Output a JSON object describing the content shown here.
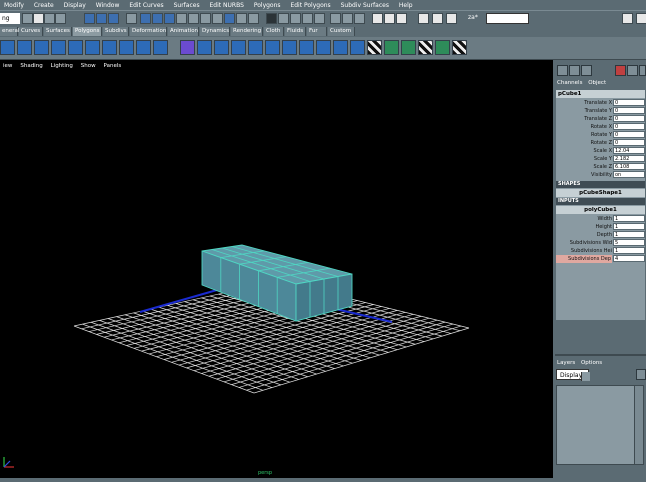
{
  "menubar": [
    "Modify",
    "Create",
    "Display",
    "Window",
    "Edit Curves",
    "Surfaces",
    "Edit NURBS",
    "Polygons",
    "Edit Polygons",
    "Subdiv Surfaces",
    "Help"
  ],
  "status": {
    "mode": "ng",
    "zoom_label": "za*"
  },
  "shelf_tabs": [
    "eneral",
    "Curves",
    "Surfaces",
    "Polygons",
    "Subdivs",
    "Deformation",
    "Animation",
    "Dynamics",
    "Rendering",
    "Cloth",
    "Fluids",
    "Fur",
    "Custom"
  ],
  "shelf_active": "Polygons",
  "view_menu": [
    "iew",
    "Shading",
    "Lighting",
    "Show",
    "Panels"
  ],
  "channel_box": {
    "tabs": [
      "Channels",
      "Object"
    ],
    "node": "pCube1",
    "attributes": [
      {
        "label": "Translate X",
        "value": "0"
      },
      {
        "label": "Translate Y",
        "value": "0"
      },
      {
        "label": "Translate Z",
        "value": "0"
      },
      {
        "label": "Rotate X",
        "value": "0"
      },
      {
        "label": "Rotate Y",
        "value": "0"
      },
      {
        "label": "Rotate Z",
        "value": "0"
      },
      {
        "label": "Scale X",
        "value": "12.04"
      },
      {
        "label": "Scale Y",
        "value": "2.182"
      },
      {
        "label": "Scale Z",
        "value": "6.108"
      },
      {
        "label": "Visibility",
        "value": "on"
      }
    ],
    "shapes_header": "SHAPES",
    "shape_node": "pCubeShape1",
    "inputs_header": "INPUTS",
    "input_node": "polyCube1",
    "input_attributes": [
      {
        "label": "Width",
        "value": "1"
      },
      {
        "label": "Height",
        "value": "1"
      },
      {
        "label": "Depth",
        "value": "1"
      },
      {
        "label": "Subdivisions Wid",
        "value": "5"
      },
      {
        "label": "Subdivisions Hei",
        "value": "1"
      },
      {
        "label": "Subdivisions Dep",
        "value": "4"
      }
    ]
  },
  "layers": {
    "tabs": [
      "Layers",
      "Options"
    ],
    "display": "Display"
  },
  "viewport": {
    "camera_label": "persp"
  },
  "colors": {
    "mesh": "#4fd6c3",
    "grid": "#e0e0e0",
    "axis_blue": "#1a2bd0",
    "background": "#000000"
  }
}
